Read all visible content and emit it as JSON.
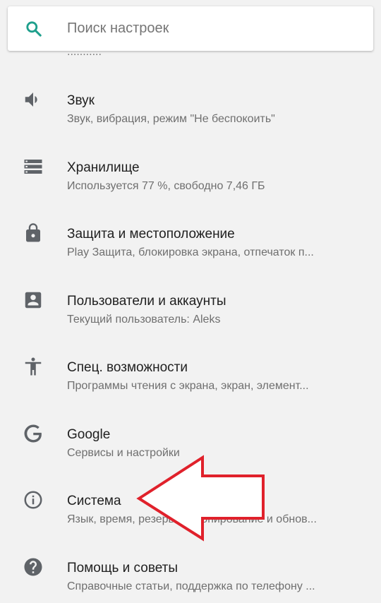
{
  "search": {
    "placeholder": "Поиск настроек",
    "icon": "search-icon",
    "accent_color": "#1e9f8c"
  },
  "top_fragment": "...........",
  "settings": [
    {
      "icon": "volume-icon",
      "title": "Звук",
      "subtitle": "Звук, вибрация, режим \"Не беспокоить\""
    },
    {
      "icon": "storage-icon",
      "title": "Хранилище",
      "subtitle": "Используется 77 %, свободно 7,46 ГБ"
    },
    {
      "icon": "lock-icon",
      "title": "Защита и местоположение",
      "subtitle": "Play Защита, блокировка экрана, отпечаток п..."
    },
    {
      "icon": "account-box-icon",
      "title": "Пользователи и аккаунты",
      "subtitle": "Текущий пользователь: Aleks"
    },
    {
      "icon": "accessibility-icon",
      "title": "Спец. возможности",
      "subtitle": "Программы чтения с экрана, экран, элемент..."
    },
    {
      "icon": "google-icon",
      "title": "Google",
      "subtitle": "Сервисы и настройки"
    },
    {
      "icon": "info-icon",
      "title": "Система",
      "subtitle": "Язык, время, резервное копирование и обнов..."
    },
    {
      "icon": "help-icon",
      "title": "Помощь и советы",
      "subtitle": "Справочные статьи, поддержка по телефону ..."
    }
  ],
  "annotation": {
    "icon": "red-arrow-icon",
    "color": "#e0212b",
    "points_to": "Система"
  },
  "colors": {
    "background": "#f2f2f2",
    "icon": "#5f6368",
    "title": "#212121",
    "subtitle": "#6f6f6f"
  }
}
